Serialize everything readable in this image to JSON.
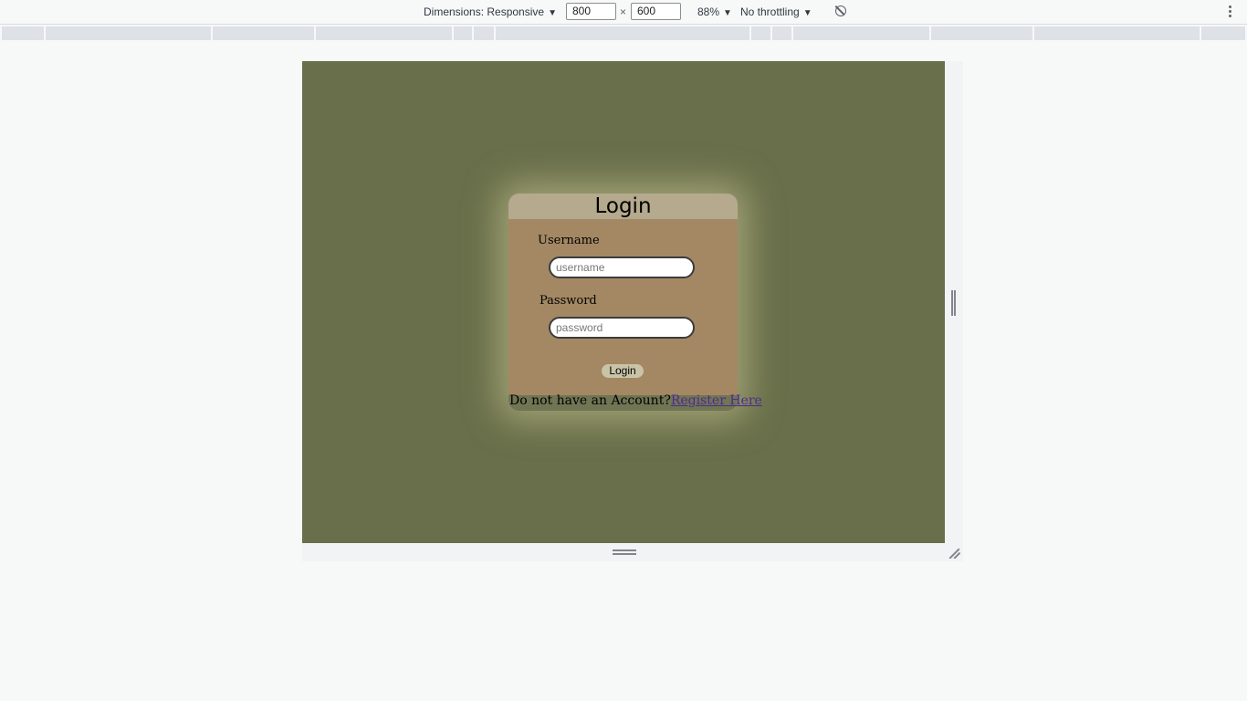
{
  "toolbar": {
    "dimensions_label": "Dimensions: Responsive",
    "width_value": "800",
    "times_sign": "×",
    "height_value": "600",
    "zoom_label": "88%",
    "throttling_label": "No throttling",
    "caret": "▼"
  },
  "icons": {
    "rotate": "rotate-icon",
    "more": "kebab-icon"
  },
  "page": {
    "background_color": "#686f4a",
    "card_color": "#a38863",
    "header_color": "#b5a98e",
    "title": "Login",
    "username_label": "Username",
    "username_placeholder": "username",
    "password_label": "Password",
    "password_placeholder": "password",
    "login_button": "Login",
    "register_prompt": "Do not have an Account?",
    "register_link": "Register Here",
    "link_color": "#4d2a90"
  }
}
